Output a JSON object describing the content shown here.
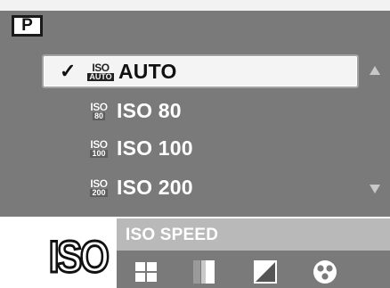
{
  "header": {
    "mode": "P"
  },
  "menu": {
    "items": [
      {
        "badge_top": "ISO",
        "badge_bottom": "AUTO",
        "label": "AUTO",
        "checked": true,
        "selected": true
      },
      {
        "badge_top": "ISO",
        "badge_bottom": "80",
        "label": "ISO 80",
        "checked": false,
        "selected": false
      },
      {
        "badge_top": "ISO",
        "badge_bottom": "100",
        "label": "ISO 100",
        "checked": false,
        "selected": false
      },
      {
        "badge_top": "ISO",
        "badge_bottom": "200",
        "label": "ISO 200",
        "checked": false,
        "selected": false
      }
    ],
    "check_mark": "✓"
  },
  "footer": {
    "current_icon_text": "ISO",
    "title": "ISO SPEED",
    "icons": [
      "grid-icon",
      "half-tone-icon",
      "diagonal-contrast-icon",
      "color-dots-icon"
    ]
  },
  "colors": {
    "panel": "#7a7a7a",
    "selection": "#f4f4f4",
    "title_bar": "#b9b9b9"
  }
}
